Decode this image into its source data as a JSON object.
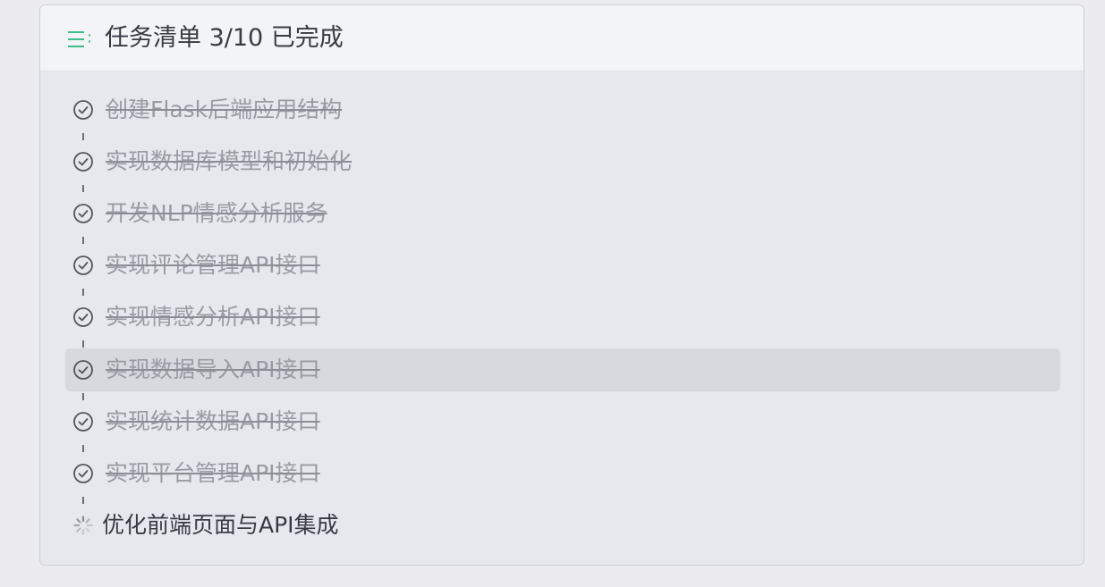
{
  "header": {
    "icon": "list-icon",
    "title": "任务清单 3/10 已完成",
    "accent_color": "#3dbd8a"
  },
  "tasks": [
    {
      "label": "创建Flask后端应用结构",
      "status": "completed"
    },
    {
      "label": "实现数据库模型和初始化",
      "status": "completed"
    },
    {
      "label": "开发NLP情感分析服务",
      "status": "completed"
    },
    {
      "label": "实现评论管理API接口",
      "status": "completed"
    },
    {
      "label": "实现情感分析API接口",
      "status": "completed"
    },
    {
      "label": "实现数据导入API接口",
      "status": "completed",
      "hovered": true
    },
    {
      "label": "实现统计数据API接口",
      "status": "completed"
    },
    {
      "label": "实现平台管理API接口",
      "status": "completed"
    },
    {
      "label": "优化前端页面与API集成",
      "status": "in-progress"
    }
  ],
  "icons": {
    "completed": "check-circle-icon",
    "in_progress": "spinner-icon"
  }
}
